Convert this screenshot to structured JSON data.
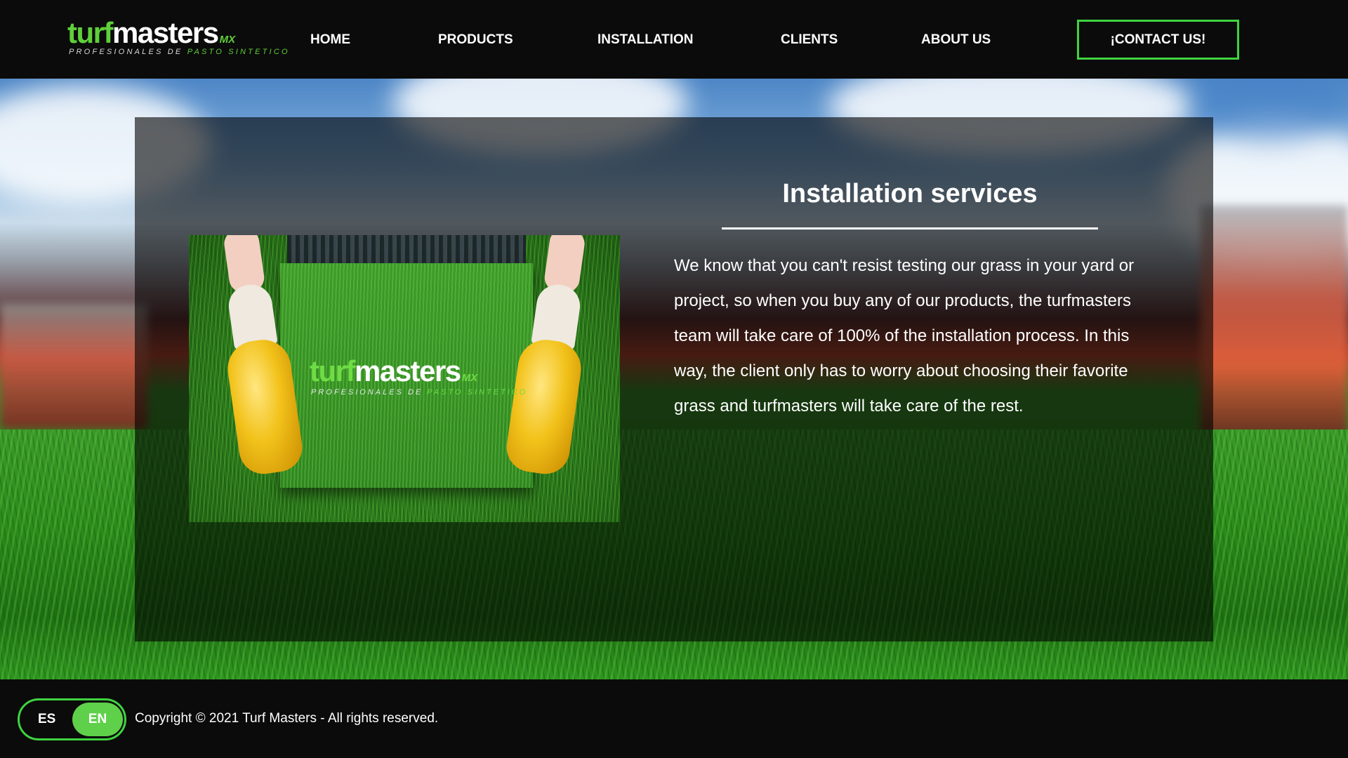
{
  "brand": {
    "logo_turf": "turf",
    "logo_masters": "masters",
    "logo_mx": "MX",
    "tagline_a": "PROFESIONALES DE ",
    "tagline_b": "PASTO SINTETICO",
    "accent_color": "#3fd33f"
  },
  "nav": {
    "items": [
      {
        "label": "HOME"
      },
      {
        "label": "PRODUCTS"
      },
      {
        "label": "INSTALLATION"
      },
      {
        "label": "CLIENTS"
      },
      {
        "label": "ABOUT US"
      }
    ],
    "contact_label": "¡CONTACT US!"
  },
  "main": {
    "title": "Installation services",
    "body": "We know that you can't resist testing our grass in your yard or project, so when you buy any of our products, the turfmasters team will take care of 100% of the installation process. In this way, the client only has to worry about choosing their favorite grass and turfmasters will take care of the rest."
  },
  "footer": {
    "lang_es": "ES",
    "lang_en": "EN",
    "lang_selected": "EN",
    "copyright": "Copyright © 2021 Turf Masters - All rights reserved."
  }
}
